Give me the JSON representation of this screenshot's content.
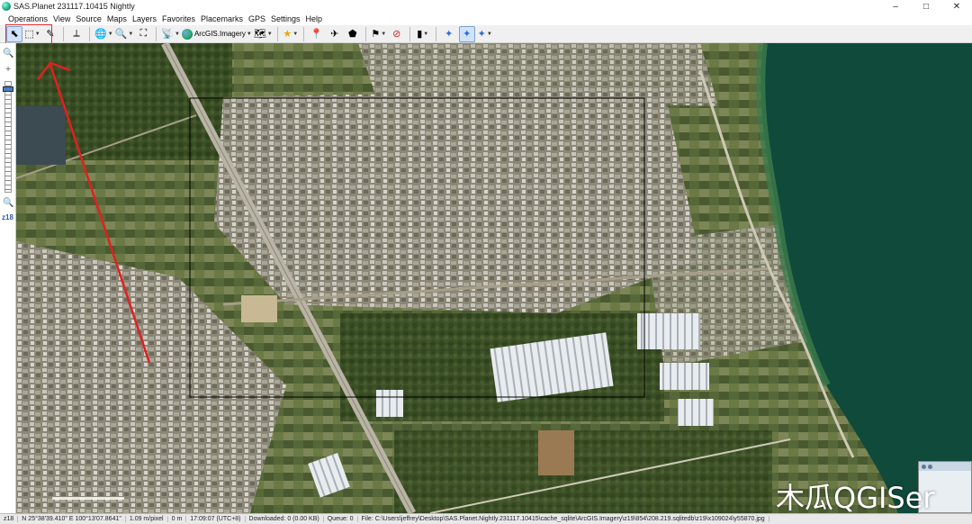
{
  "window": {
    "title": "SAS.Planet 231117.10415 Nightly",
    "controls": {
      "minimize": "–",
      "maximize": "□",
      "close": "✕"
    }
  },
  "menu": {
    "items": [
      "Operations",
      "View",
      "Source",
      "Maps",
      "Layers",
      "Favorites",
      "Placemarks",
      "GPS",
      "Settings",
      "Help"
    ]
  },
  "toolbar": {
    "map_source_label": "ArcGIS.Imagery",
    "buttons": [
      {
        "name": "pointer-icon",
        "glyph": "⬉",
        "active": true,
        "dropdown": false
      },
      {
        "name": "select-area-icon",
        "glyph": "⬚",
        "active": false,
        "dropdown": true
      },
      {
        "name": "ruler-pencil-icon",
        "glyph": "✎",
        "active": false,
        "dropdown": false
      },
      {
        "name": "measure-icon",
        "glyph": "⟂",
        "active": false,
        "dropdown": false
      },
      {
        "name": "globe-icon",
        "glyph": "🌐",
        "active": false,
        "dropdown": true
      },
      {
        "name": "magnifier-icon",
        "glyph": "🔍",
        "active": false,
        "dropdown": true
      },
      {
        "name": "fullscreen-icon",
        "glyph": "⛶",
        "active": false,
        "dropdown": false
      },
      {
        "name": "satellite-dish-icon",
        "glyph": "📡",
        "active": false,
        "dropdown": true
      }
    ],
    "buttons_after": [
      {
        "name": "layers-icon",
        "glyph": "🗺",
        "active": false,
        "dropdown": true
      },
      {
        "name": "favorites-star-icon",
        "glyph": "★",
        "active": false,
        "dropdown": true
      },
      {
        "name": "placemark-pin-icon",
        "glyph": "📍",
        "active": false,
        "dropdown": false
      },
      {
        "name": "route-icon",
        "glyph": "✈",
        "active": false,
        "dropdown": false
      },
      {
        "name": "polygon-icon",
        "glyph": "⬟",
        "active": false,
        "dropdown": false
      },
      {
        "name": "marks-visible-icon",
        "glyph": "⚑",
        "active": false,
        "dropdown": true
      },
      {
        "name": "marks-hide-icon",
        "glyph": "⊘",
        "active": false,
        "dropdown": false
      },
      {
        "name": "gps-device-icon",
        "glyph": "▮",
        "active": false,
        "dropdown": true
      },
      {
        "name": "gps-connect-icon",
        "glyph": "✦",
        "active": false,
        "dropdown": false
      },
      {
        "name": "gps-track-icon",
        "glyph": "✦",
        "active": true,
        "dropdown": false
      },
      {
        "name": "gps-center-icon",
        "glyph": "✦",
        "active": false,
        "dropdown": true
      }
    ]
  },
  "zoom": {
    "level": "z18"
  },
  "status": {
    "zoom": "z18",
    "coords": "N 25°38'39.410\"  E 100°13'07.8641\"",
    "scale": "1.09 m/pixel",
    "distance": "0 m",
    "time": "17:09:07 (UTC+8)",
    "download": "Downloaded: 0 (0.00 KB)",
    "queue": "Queue: 0",
    "file": "File: C:\\Users\\jeffrey\\Desktop\\SAS.Planet.Nightly.231117.10415\\cache_sqlite\\ArcGIS.Imagery\\z19\\854\\208.219.sqlitedb\\z19\\x109024\\y55870.jpg"
  },
  "watermark": "木瓜QGISer",
  "colors": {
    "highlight": "#e03030",
    "arrow": "#e02020",
    "water": "#0f4a3a",
    "selection": "#000000"
  }
}
